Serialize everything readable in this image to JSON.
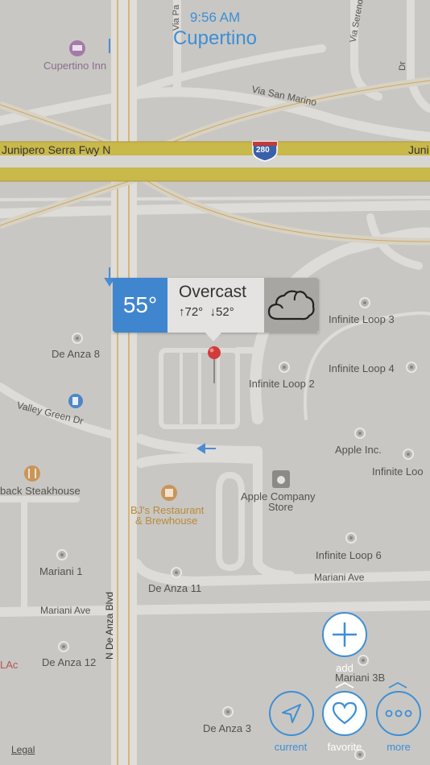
{
  "status": {
    "time": "9:56 AM",
    "city": "Cupertino"
  },
  "weather": {
    "temperature": "55°",
    "condition": "Overcast",
    "high": "72°",
    "low": "52°",
    "icon": "cloud-icon"
  },
  "map_labels": {
    "cupertino_inn": "Cupertino Inn",
    "via_san_marino": "Via San Marino",
    "junipero_left": "Junipero Serra Fwy N",
    "junipero_right": "Juni",
    "hwy_280": "280",
    "de_anza_8": "De Anza 8",
    "valley_green": "Valley Green Dr",
    "steakhouse": "back Steakhouse",
    "bjs_1": "BJ's Restaurant",
    "bjs_2": "& Brewhouse",
    "apple_store_1": "Apple Company",
    "apple_store_2": "Store",
    "infinite_3": "Infinite Loop 3",
    "infinite_4": "Infinite Loop 4",
    "infinite_2": "Infinite Loop 2",
    "apple_inc": "Apple Inc.",
    "infinite_trunc": "Infinite Loo",
    "infinite_6": "Infinite Loop 6",
    "mariani_1": "Mariani 1",
    "de_anza_11": "De Anza 11",
    "mariani_ave_1": "Mariani Ave",
    "mariani_ave_2": "Mariani Ave",
    "n_de_anza": "N De Anza Blvd",
    "de_anza_12": "De Anza 12",
    "lac": "LAc",
    "mariani_3b": "Mariani 3B",
    "de_anza_3": "De Anza 3",
    "via_vertical_1": "Via Pa",
    "via_vertical_2": "Via Sereno",
    "dr_vertical": "Dr"
  },
  "buttons": {
    "add": "add",
    "current": "current",
    "favorite": "favorite",
    "more": "more"
  },
  "legal": "Legal",
  "colors": {
    "accent": "#3d8fd6",
    "temp_bg": "#3f86cf",
    "highway": "#c9b84a",
    "pin": "#d23b3b"
  }
}
